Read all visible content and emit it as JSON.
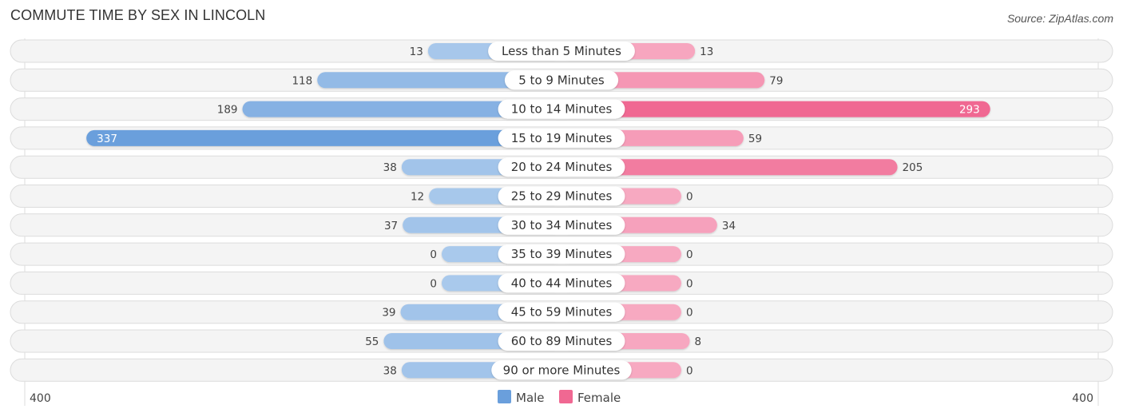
{
  "header": {
    "title": "COMMUTE TIME BY SEX IN LINCOLN",
    "source": "Source: ZipAtlas.com"
  },
  "chart_data": {
    "type": "bar",
    "orientation": "horizontal-diverging",
    "title": "COMMUTE TIME BY SEX IN LINCOLN",
    "categories": [
      "Less than 5 Minutes",
      "5 to 9 Minutes",
      "10 to 14 Minutes",
      "15 to 19 Minutes",
      "20 to 24 Minutes",
      "25 to 29 Minutes",
      "30 to 34 Minutes",
      "35 to 39 Minutes",
      "40 to 44 Minutes",
      "45 to 59 Minutes",
      "60 to 89 Minutes",
      "90 or more Minutes"
    ],
    "series": [
      {
        "name": "Male",
        "color": "#6a9fdc",
        "values": [
          13,
          118,
          189,
          337,
          38,
          12,
          37,
          0,
          0,
          39,
          55,
          38
        ]
      },
      {
        "name": "Female",
        "color": "#f06892",
        "values": [
          13,
          79,
          293,
          59,
          205,
          0,
          34,
          0,
          0,
          0,
          8,
          0
        ]
      }
    ],
    "axis": {
      "left_label": "400",
      "right_label": "400",
      "max": 400
    },
    "legend": {
      "position": "bottom-center",
      "items": [
        "Male",
        "Female"
      ]
    },
    "grid": false
  }
}
